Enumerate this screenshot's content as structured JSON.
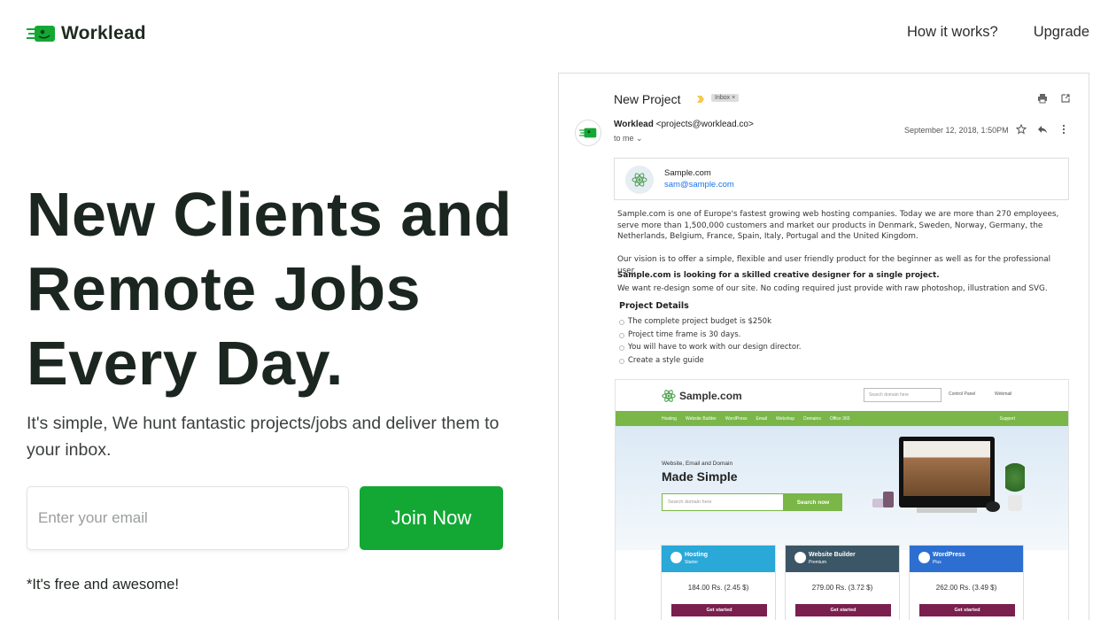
{
  "header": {
    "logo_text": "Worklead",
    "nav": [
      {
        "label": "How it works?"
      },
      {
        "label": "Upgrade"
      }
    ]
  },
  "hero": {
    "headline_lines": [
      "New Clients and",
      "Remote Jobs",
      "Every Day."
    ],
    "subtext": "It's simple, We hunt fantastic projects/jobs and deliver them to your inbox.",
    "email_placeholder": "Enter your email",
    "cta_label": "Join Now",
    "note": "*It's free and awesome!"
  },
  "email": {
    "subject": "New Project",
    "label": "Inbox ×",
    "sender_name": "Worklead",
    "sender_email": "<projects@worklead.co>",
    "recipient": "to me",
    "date": "September 12, 2018, 1:50PM",
    "contact_name": "Sample.com",
    "contact_email": "sam@sample.com",
    "paragraphs": [
      "Sample.com is one of Europe's fastest growing web hosting companies. Today we are more than 270 employees, serve more than 1,500,000 customers and market our products in Denmark, Sweden, Norway, Germany, the Netherlands, Belgium, France, Spain, Italy, Portugal and the United Kingdom.",
      "Our vision is to offer a simple, flexible and user friendly product for the beginner as well as for the professional user.",
      "Sample.com is looking for a skilled creative designer for a single project.",
      "We want re-design some of our site. No coding required just provide with raw photoshop, illustration and SVG."
    ],
    "details_title": "Project Details",
    "details": [
      "The complete project budget is $250k",
      "Project time frame is 30 days.",
      "You will have to work with our design director.",
      "Create a style guide"
    ]
  },
  "site": {
    "logo_text": "Sample.com",
    "search_placeholder": "Search domain here",
    "control_panel": "Control Panel",
    "webmail": "Webmail",
    "nav": [
      "Hosting",
      "Website Builder",
      "WordPress",
      "Email",
      "Webshop",
      "Domains",
      "Office 365"
    ],
    "support": "Support",
    "hero_sub": "Website, Email and Domain",
    "hero_title": "Made Simple",
    "hero_input": "Search domain here",
    "hero_button": "Search now",
    "plans": [
      {
        "name": "Hosting",
        "tier": "Starter",
        "price": "184.00 Rs. (2.45 $)",
        "button": "Get started",
        "color": "#2aa8d8"
      },
      {
        "name": "Website Builder",
        "tier": "Premium",
        "price": "279.00 Rs. (3.72 $)",
        "button": "Get started",
        "color": "#3b5666"
      },
      {
        "name": "WordPress",
        "tier": "Plus",
        "price": "262.00 Rs. (3.49 $)",
        "button": "Get started",
        "color": "#2d6fd0"
      }
    ]
  },
  "colors": {
    "brand_green": "#13a834",
    "site_green": "#7ab648",
    "cta_maroon": "#7a1f4e",
    "link_blue": "#1a73e8"
  }
}
